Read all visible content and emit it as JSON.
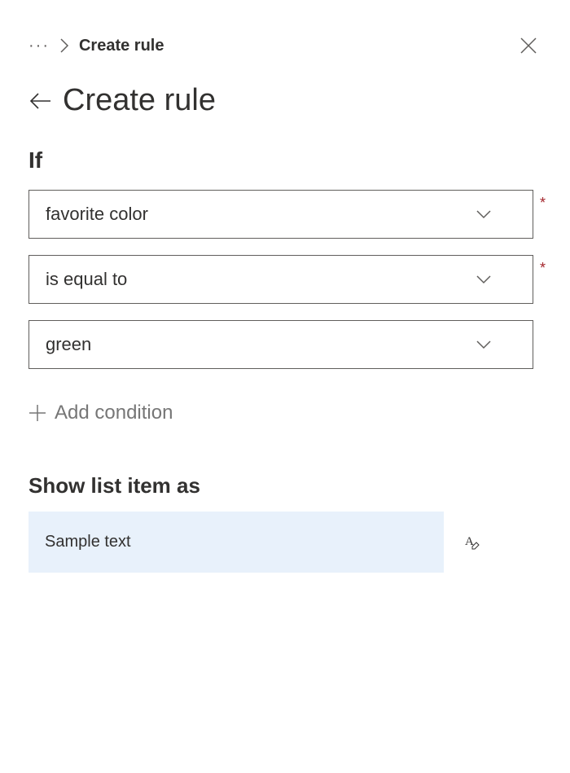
{
  "breadcrumb": {
    "current": "Create rule"
  },
  "title": "Create rule",
  "section_if": "If",
  "condition": {
    "field_label": "favorite color",
    "operator_label": "is equal to",
    "value_label": "green"
  },
  "required_marker": "*",
  "add_condition_label": "Add condition",
  "show_section_label": "Show list item as",
  "sample_text": "Sample text"
}
